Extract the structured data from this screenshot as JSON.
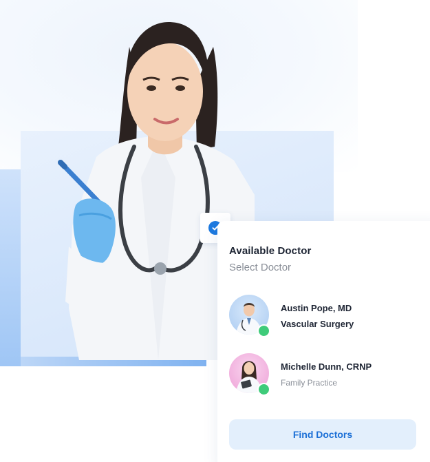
{
  "card": {
    "title": "Available Doctor",
    "subtitle": "Select Doctor",
    "doctors": [
      {
        "name": "Austin Pope, MD",
        "specialty": "Vascular Surgery",
        "avatar_icon": "male-doctor-avatar",
        "status": "online"
      },
      {
        "name": "Michelle Dunn, CRNP",
        "specialty": "Family Practice",
        "avatar_icon": "female-doctor-avatar",
        "status": "online"
      }
    ],
    "find_button_label": "Find Doctors"
  },
  "badge": {
    "icon": "check-circle-icon"
  },
  "colors": {
    "accent": "#1d7ae0",
    "button_bg": "#e3effc",
    "button_text": "#1b6fd6",
    "online": "#3fcb7a",
    "panel_blue": "#dbe9fb"
  }
}
